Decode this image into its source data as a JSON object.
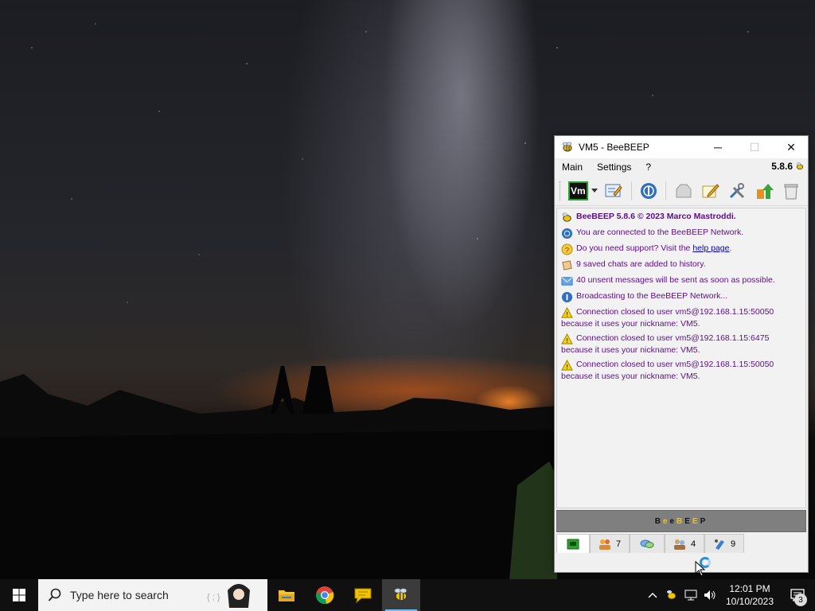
{
  "window": {
    "title": "VM5 - BeeBEEP",
    "minimize": "─",
    "maximize": "☐",
    "close": "✕"
  },
  "menu": {
    "items": [
      "Main",
      "Settings",
      "?"
    ],
    "version": "5.8.6"
  },
  "toolbar": {
    "user_badge": "Vm"
  },
  "log": {
    "title": "BeeBEEP 5.8.6 © 2023 Marco Mastroddi.",
    "connected": "You are connected to the BeeBEEP Network.",
    "support_prefix": "Do you need support? Visit the ",
    "support_link": "help page",
    "support_suffix": ".",
    "saved_chats": "9 saved chats are added to history.",
    "unsent": "40 unsent messages will be sent as soon as possible.",
    "broadcasting": "Broadcasting to the BeeBEEP Network...",
    "closed": [
      {
        "line1": "Connection closed to user vm5@192.168.1.15:50050",
        "line2": "because it uses your nickname: VM5."
      },
      {
        "line1": "Connection closed to user vm5@192.168.1.15:6475",
        "line2": "because it uses your nickname: VM5."
      },
      {
        "line1": "Connection closed to user vm5@192.168.1.15:50050",
        "line2": "because it uses your nickname: VM5."
      }
    ]
  },
  "brand_bar": {
    "letters": [
      "B",
      "e",
      "e",
      "B",
      "E",
      "E",
      "P"
    ],
    "colors": [
      "#111111",
      "#f2c400",
      "#111111",
      "#f2c400",
      "#111111",
      "#f2c400",
      "#111111"
    ]
  },
  "tabs": [
    {
      "count": ""
    },
    {
      "count": "7"
    },
    {
      "count": ""
    },
    {
      "count": "4"
    },
    {
      "count": "9"
    }
  ],
  "taskbar": {
    "search_placeholder": "Type here to search",
    "time": "12:01 PM",
    "date": "10/10/2023",
    "notification_count": "3"
  }
}
